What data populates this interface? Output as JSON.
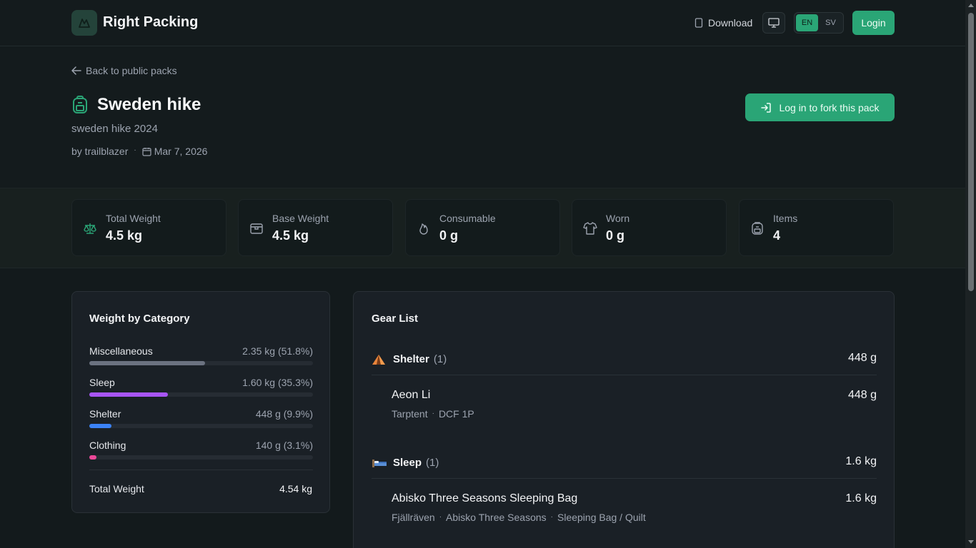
{
  "header": {
    "brand": "Right Packing",
    "download_label": "Download",
    "lang_en": "EN",
    "lang_sv": "SV",
    "login_label": "Login"
  },
  "pack": {
    "back_label": "Back to public packs",
    "title": "Sweden hike",
    "description": "sweden hike 2024",
    "author": "by trailblazer",
    "date": "Mar 7, 2026",
    "fork_label": "Log in to fork this pack"
  },
  "stats": [
    {
      "label": "Total Weight",
      "value": "4.5 kg",
      "icon": "scale-icon"
    },
    {
      "label": "Base Weight",
      "value": "4.5 kg",
      "icon": "box-icon"
    },
    {
      "label": "Consumable",
      "value": "0 g",
      "icon": "flame-icon"
    },
    {
      "label": "Worn",
      "value": "0 g",
      "icon": "shirt-icon"
    },
    {
      "label": "Items",
      "value": "4",
      "icon": "backpack-icon"
    }
  ],
  "weight_by_category": {
    "title": "Weight by Category",
    "categories": [
      {
        "name": "Miscellaneous",
        "weight": "2.35 kg (51.8%)",
        "percent": 51.8,
        "color": "#6b7280"
      },
      {
        "name": "Sleep",
        "weight": "1.60 kg (35.3%)",
        "percent": 35.3,
        "color": "#a855f7"
      },
      {
        "name": "Shelter",
        "weight": "448 g (9.9%)",
        "percent": 9.9,
        "color": "#3b82f6"
      },
      {
        "name": "Clothing",
        "weight": "140 g (3.1%)",
        "percent": 3.1,
        "color": "#ec4899"
      }
    ],
    "total_label": "Total Weight",
    "total_value": "4.54 kg"
  },
  "gear_list": {
    "title": "Gear List",
    "groups": [
      {
        "emoji": "⛺",
        "name": "Shelter",
        "count": "(1)",
        "weight": "448 g",
        "items": [
          {
            "name": "Aeon Li",
            "weight": "448 g",
            "brand": "Tarptent",
            "model": "DCF 1P",
            "category": ""
          }
        ]
      },
      {
        "emoji": "🛏",
        "name": "Sleep",
        "count": "(1)",
        "weight": "1.6 kg",
        "items": [
          {
            "name": "Abisko Three Seasons Sleeping Bag",
            "weight": "1.6 kg",
            "brand": "Fjällräven",
            "model": "Abisko Three Seasons",
            "category": "Sleeping Bag / Quilt"
          }
        ]
      }
    ]
  },
  "colors": {
    "accent": "#2aa576",
    "background": "#131a1c",
    "card": "#1a2026"
  }
}
